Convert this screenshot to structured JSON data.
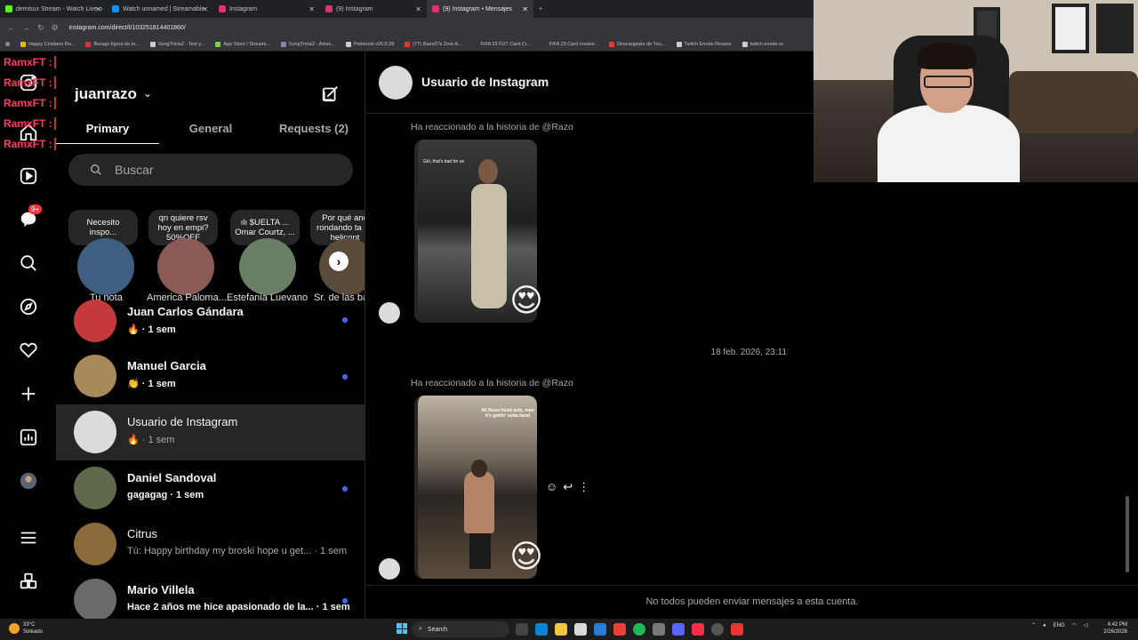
{
  "browser": {
    "tabs": [
      {
        "title": "demisux Stream - Watch Live o",
        "color": "#53fc18"
      },
      {
        "title": "Watch unnamed | Streamable",
        "color": "#0f90fa"
      },
      {
        "title": "Instagram",
        "color": "#e1306c"
      },
      {
        "title": "(9) Instagram",
        "color": "#e1306c"
      },
      {
        "title": "(9) Instagram • Mensajes",
        "color": "#e1306c"
      }
    ],
    "new_tab": "+",
    "url": "instagram.com/direct/t/103251814401860/",
    "bookmarks": [
      "Happy Cristiano Ro...",
      "Burago figura de to...",
      "SongTrivia2 - Test y...",
      "App Store / Streami...",
      "SongTrivia2 - Advin...",
      "Paletools v26.0.28",
      "(77) Razo97s Zest-A...",
      "FIFA 23 FUT Card Cr...",
      "FIFA 23 Card creator...",
      "Descargador de You...",
      "Twitch Emote Resizer",
      "twitch emote re"
    ]
  },
  "stream_overlay": {
    "chat_users": [
      "RamxFT :",
      "RamxFT :",
      "RamxFT :",
      "RamxFT :",
      "RamxFT :"
    ]
  },
  "nav": {
    "icons": [
      "instagram-logo-icon",
      "home-icon",
      "reels-icon",
      "messenger-icon",
      "search-icon",
      "explore-icon",
      "heart-icon",
      "create-icon",
      "dashboard-icon",
      "profile-icon",
      "menu-icon",
      "more-apps-icon"
    ],
    "badge": "9+"
  },
  "dm": {
    "username": "juanrazo",
    "tabs": [
      "Primary",
      "General",
      "Requests (2)"
    ],
    "search_placeholder": "Buscar",
    "notes": [
      {
        "bubble": "Necesito inspo...",
        "name": "Tu nota",
        "color": "#3f5f80"
      },
      {
        "bubble": "qn quiere rsv hoy en empi? 50%OFF",
        "name": "America Paloma...",
        "color": "#8a5a55"
      },
      {
        "bubble": "ılı $UELTA ... Omar Courtz, ...",
        "name": "Estefania Luevano",
        "color": "#6b7f66"
      },
      {
        "bubble": "Por qué and rondando ta un helicopt",
        "name": "Sr. de las ba",
        "color": "#5a4b3b"
      }
    ],
    "threads": [
      {
        "name": "Juan Carlos Gándara",
        "preview": "🔥 · 1 sem",
        "unread": true,
        "color": "#c43a3a"
      },
      {
        "name": "Manuel Garcia",
        "preview": "👏 · 1 sem",
        "unread": true,
        "color": "#a7895a"
      },
      {
        "name": "Usuario de Instagram",
        "preview": "🔥 · 1 sem",
        "unread": false,
        "color": "#dbdbdb"
      },
      {
        "name": "Daniel Sandoval",
        "preview": "gagagag · 1 sem",
        "unread": true,
        "color": "#5f6a4a"
      },
      {
        "name": "Citrus",
        "preview": "Tú: Happy birthday my broski hope u get... · 1 sem",
        "unread": false,
        "color": "#8a6a3a"
      },
      {
        "name": "Mario Villela",
        "preview": "Hace 2 años me hice apasionado de la... · 1 sem",
        "unread": true,
        "color": "#6a6a6a"
      }
    ]
  },
  "chat": {
    "title": "Usuario de Instagram",
    "react1": "Ha reaccionado a la historia de @Razo",
    "story1_caption": "Girl, that's bad for us",
    "timestamp": "18 feb. 2026, 23:11",
    "react2": "Ha reaccionado a la historia de @Razo",
    "story2_caption": "All these hood outs, man it's gettin' outta hand",
    "reaction_emoji": "😍",
    "footer": "No todos pueden enviar mensajes a esta cuenta."
  },
  "taskbar": {
    "temp": "33°C",
    "condition": "Soleado",
    "search": "Search",
    "lang": "ENG",
    "time": "4:42 PM",
    "date": "2/26/2026"
  }
}
